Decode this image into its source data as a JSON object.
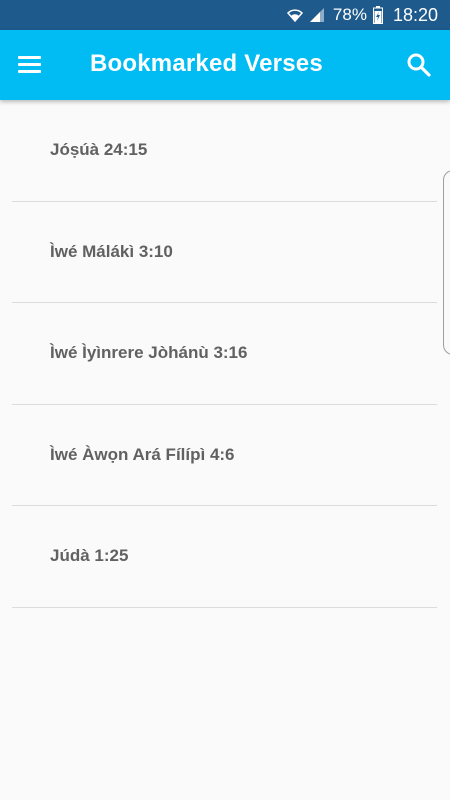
{
  "status_bar": {
    "battery_percent": "78%",
    "time": "18:20",
    "icons": [
      "wifi-icon",
      "signal-icon",
      "battery-charging-icon"
    ]
  },
  "app_bar": {
    "title": "Bookmarked Verses",
    "menu_icon": "hamburger-menu-icon",
    "search_icon": "search-icon",
    "color": "#00bcf2"
  },
  "bookmarks": [
    {
      "label": "Jóṣúà 24:15"
    },
    {
      "label": "Ìwé Málákì 3:10"
    },
    {
      "label": "Ìwé Ìyìnrere Jòhánù 3:16"
    },
    {
      "label": "Ìwé Àwọn Ará Fílípì 4:6"
    },
    {
      "label": "Júdà 1:25"
    }
  ]
}
